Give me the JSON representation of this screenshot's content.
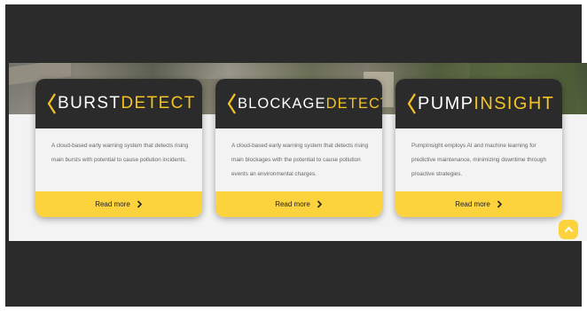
{
  "colors": {
    "page_dark": "#2b2b2b",
    "band": "#f3f3f3",
    "accent_yellow": "#fcd23d",
    "logo_yellow": "#f3c325"
  },
  "cards": [
    {
      "logo_white": "BURST",
      "logo_yellow": "DETECT",
      "description": "A cloud-based early warning system that detects rising main bursts with potential to cause pollution incidents.",
      "button_label": "Read more",
      "button_icon": "chevron-right-icon"
    },
    {
      "logo_white": "BLOCKAGE",
      "logo_yellow": "DETECT",
      "description": "A cloud-based early warning system that detects rising main blockages with the potential to cause pollution events an environmental charges.",
      "button_label": "Read more",
      "button_icon": "chevron-right-icon"
    },
    {
      "logo_white": "PUMP",
      "logo_yellow": "INSIGHT",
      "description": "PumpInsight employs AI and machine learning for predictive maintenance, minimizing downtime through proactive strategies.",
      "button_label": "Read more",
      "button_icon": "chevron-right-icon"
    }
  ],
  "scroll_top": {
    "icon": "chevron-up-icon"
  }
}
